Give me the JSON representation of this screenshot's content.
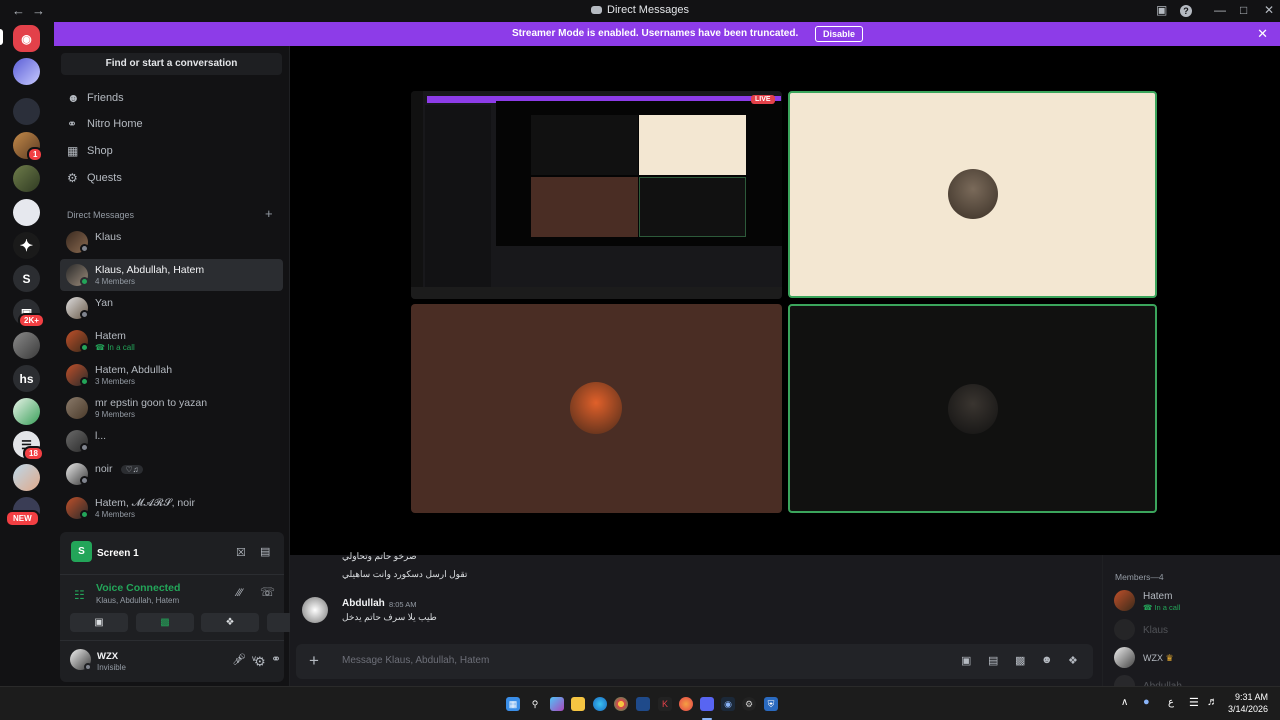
{
  "window": {
    "title": "Direct Messages",
    "back_icon": "arrow-left",
    "forward_icon": "arrow-right"
  },
  "banner": {
    "text": "Streamer Mode is enabled. Usernames have been truncated.",
    "button": "Disable",
    "color": "#8d3ce8"
  },
  "rail": {
    "badges": {
      "count1": "1",
      "count2k": "2K+",
      "count18": "18",
      "new": "NEW"
    },
    "letters": {
      "s": "S",
      "hs": "hs"
    }
  },
  "sidebar": {
    "search_placeholder": "Find or start a conversation",
    "nav": [
      {
        "label": "Friends",
        "icon": "friends-icon"
      },
      {
        "label": "Nitro Home",
        "icon": "nitro-icon"
      },
      {
        "label": "Shop",
        "icon": "shop-icon"
      },
      {
        "label": "Quests",
        "icon": "quests-icon"
      }
    ],
    "dm_header": "Direct Messages",
    "dms": [
      {
        "name": "Klaus",
        "sub": ""
      },
      {
        "name": "Klaus, Abdullah, Hatem",
        "sub": "4 Members",
        "selected": true
      },
      {
        "name": "Yan",
        "sub": ""
      },
      {
        "name": "Hatem",
        "sub": "In a call"
      },
      {
        "name": "Hatem, Abdullah",
        "sub": "3 Members"
      },
      {
        "name": "mr epstin goon to yazan",
        "sub": "9 Members"
      },
      {
        "name": "l...",
        "sub": ""
      },
      {
        "name": "noir",
        "sub": ""
      },
      {
        "name": "Hatem, 𝓜𝓐𝓡𝓢, noir",
        "sub": "4 Members"
      }
    ]
  },
  "panel": {
    "screen_label": "Screen 1",
    "voice_status": "Voice Connected",
    "voice_channel": "Klaus, Abdullah, Hatem",
    "user_name": "WZX",
    "user_status": "Invisible",
    "status_color": "#23a559"
  },
  "stage": {
    "live_badge": "LIVE"
  },
  "chat": {
    "line1": "صرخو حاتم وتحاولي",
    "line2": "تقول ارسل دسكورد وانت ساهيلي",
    "author": "Abdullah",
    "time": "8:05 AM",
    "line3": "طيب يلا سرف حاتم يدخل",
    "composer_placeholder": "Message Klaus, Abdullah, Hatem"
  },
  "members": {
    "header": "Members—4",
    "list": [
      {
        "name": "Hatem",
        "sub": "In a call"
      },
      {
        "name": "Klaus",
        "sub": ""
      },
      {
        "name": "WZX",
        "sub": ""
      },
      {
        "name": "Abdullah",
        "sub": ""
      }
    ]
  },
  "taskbar": {
    "time": "9:31 AM",
    "date": "3/14/2026",
    "lang": "ع"
  }
}
